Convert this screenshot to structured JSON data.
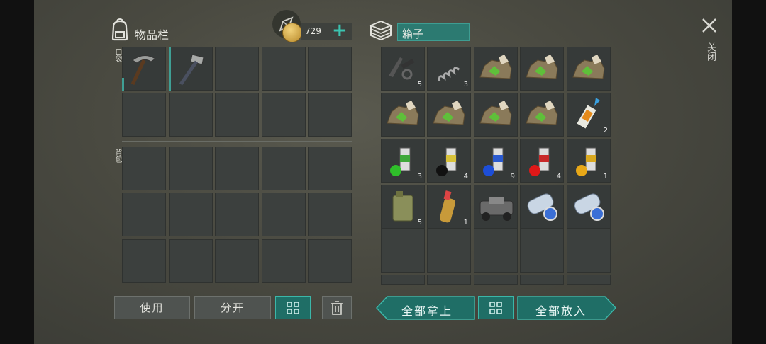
{
  "inventory": {
    "title": "物品栏",
    "pocket_label": "口袋",
    "backpack_label": "背包"
  },
  "currency": {
    "amount": "729",
    "add_symbol": "+"
  },
  "box": {
    "title": "箱子"
  },
  "close": {
    "label": "关闭"
  },
  "buttons": {
    "use": "使用",
    "split": "分开",
    "take_all": "全部拿上",
    "put_all": "全部放入"
  },
  "box_items": [
    {
      "name": "gun-parts",
      "count": "5"
    },
    {
      "name": "spring",
      "count": "3"
    },
    {
      "name": "ore",
      "count": ""
    },
    {
      "name": "ore",
      "count": ""
    },
    {
      "name": "ore",
      "count": ""
    },
    {
      "name": "ore",
      "count": ""
    },
    {
      "name": "ore",
      "count": ""
    },
    {
      "name": "ore",
      "count": ""
    },
    {
      "name": "ore",
      "count": ""
    },
    {
      "name": "glue",
      "count": "2"
    },
    {
      "name": "spray-paint-green",
      "count": "3"
    },
    {
      "name": "spray-paint-black",
      "count": "4"
    },
    {
      "name": "spray-paint-blue",
      "count": "9"
    },
    {
      "name": "spray-paint-red",
      "count": "4"
    },
    {
      "name": "spray-paint-yellow",
      "count": "1"
    },
    {
      "name": "jerrycan",
      "count": "5"
    },
    {
      "name": "bottle",
      "count": "1"
    },
    {
      "name": "vehicle-chassis",
      "count": ""
    },
    {
      "name": "blueprint-scroll",
      "count": ""
    },
    {
      "name": "blueprint-scroll",
      "count": ""
    }
  ],
  "colors": {
    "teal_accent": "#3bb6a8",
    "teal_fill": "#1f6e66",
    "slot_bg": "#3c403e"
  }
}
